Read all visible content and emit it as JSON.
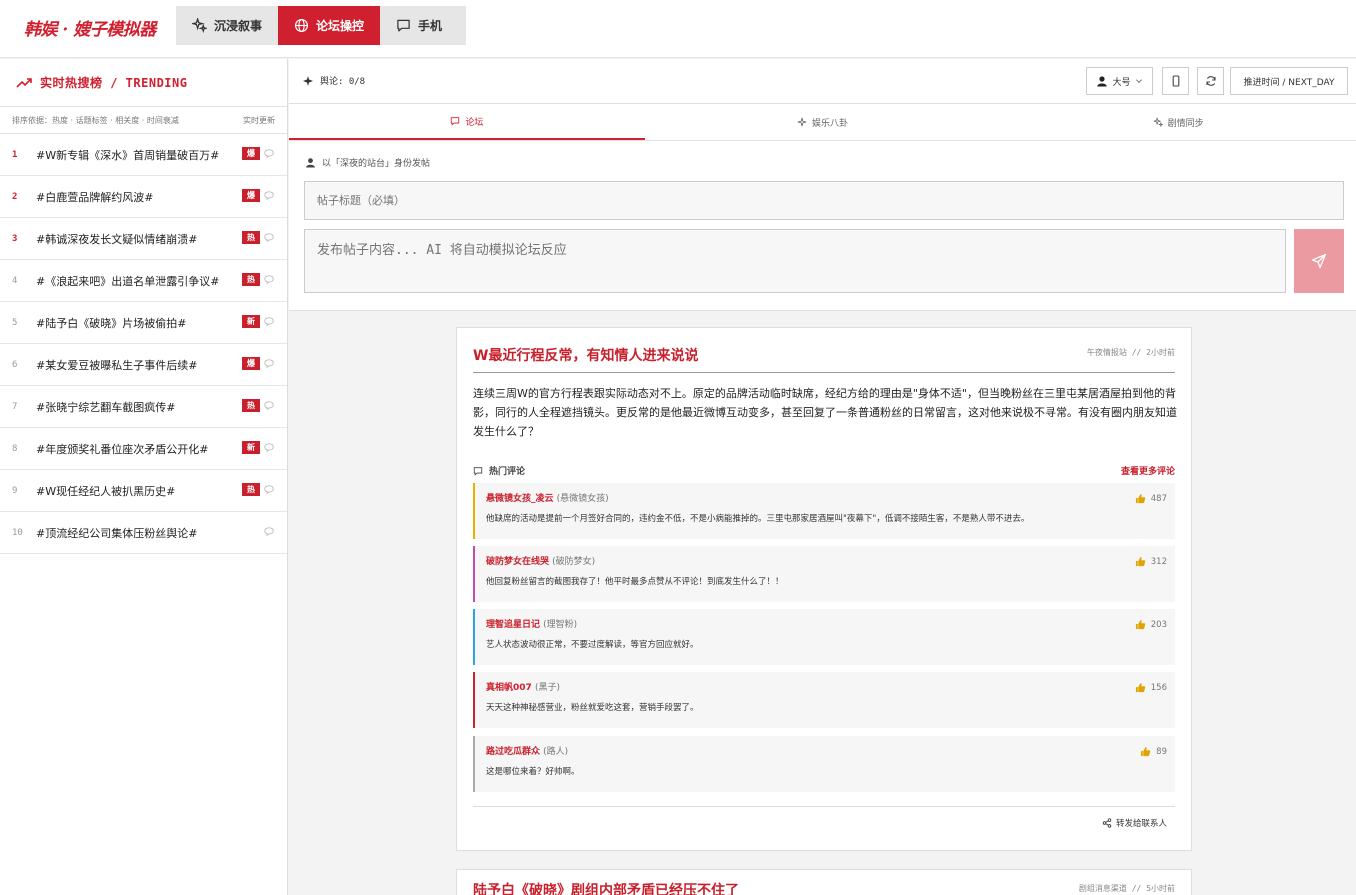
{
  "app": {
    "brand": "韩娱 · 嫂子模拟器",
    "modes": [
      {
        "label": "沉浸叙事",
        "icon": "sparkle-icon"
      },
      {
        "label": "论坛操控",
        "icon": "globe-icon"
      },
      {
        "label": "手机",
        "icon": "message-icon"
      }
    ],
    "active_mode": 1,
    "accent": "#d0202f"
  },
  "sidebar": {
    "title": "实时热搜榜 / TRENDING",
    "sort_text": "排序依据：热度 · 话题标签 · 相关度 · 时间衰减",
    "realtime": "实时更新",
    "items": [
      {
        "rank": "1",
        "title": "#W新专辑《深水》首周销量破百万#",
        "badge": "爆"
      },
      {
        "rank": "2",
        "title": "#白鹿萱品牌解约风波#",
        "badge": "爆"
      },
      {
        "rank": "3",
        "title": "#韩诚深夜发长文疑似情绪崩溃#",
        "badge": "热"
      },
      {
        "rank": "4",
        "title": "#《浪起来吧》出道名单泄露引争议#",
        "badge": "热"
      },
      {
        "rank": "5",
        "title": "#陆予白《破晓》片场被偷拍#",
        "badge": "新"
      },
      {
        "rank": "6",
        "title": "#某女爱豆被曝私生子事件后续#",
        "badge": "爆"
      },
      {
        "rank": "7",
        "title": "#张晓宁综艺翻车截图疯传#",
        "badge": "热"
      },
      {
        "rank": "8",
        "title": "#年度颁奖礼番位座次矛盾公开化#",
        "badge": "新"
      },
      {
        "rank": "9",
        "title": "#W现任经纪人被扒黑历史#",
        "badge": "热"
      },
      {
        "rank": "10",
        "title": "#顶流经纪公司集体压粉丝舆论#",
        "badge": ""
      }
    ]
  },
  "toolbar": {
    "counter": "舆论: 0/8",
    "account": "大号",
    "advance": "推进时间 / NEXT_DAY"
  },
  "tabs": [
    {
      "label": "论坛",
      "icon": "chat-icon"
    },
    {
      "label": "娱乐八卦",
      "icon": "sparkle-icon"
    },
    {
      "label": "剧情同步",
      "icon": "sparkles-icon"
    }
  ],
  "compose": {
    "identity": "以「深夜的站台」身份发帖",
    "title_placeholder": "帖子标题（必填）",
    "body_placeholder": "发布帖子内容... AI 将自动模拟论坛反应"
  },
  "posts": [
    {
      "title": "W最近行程反常，有知情人进来说说",
      "meta": "午夜情报站 // 2小时前",
      "body": "连续三周W的官方行程表跟实际动态对不上。原定的品牌活动临时缺席，经纪方给的理由是\"身体不适\"，但当晚粉丝在三里屯某居酒屋拍到他的背影，同行的人全程遮挡镜头。更反常的是他最近微博互动变多，甚至回复了一条普通粉丝的日常留言，这对他来说极不寻常。有没有圈内朋友知道发生什么了？",
      "hot_label": "热门评论",
      "more_label": "查看更多评论",
      "share_label": "转发给联系人",
      "comments": [
        {
          "name": "悬微镜女孩_凌云",
          "tag": "(悬微镜女孩)",
          "text": "他缺席的活动是提前一个月签好合同的，违约金不低，不是小病能推掉的。三里屯那家居酒屋叫\"夜幕下\"，低调不接陌生客，不是熟人带不进去。",
          "likes": "487",
          "color": "#e5b100"
        },
        {
          "name": "破防梦女在线哭",
          "tag": "(破防梦女)",
          "text": "他回复粉丝留言的截图我存了！他平时最多点赞从不评论！到底发生什么了！！",
          "likes": "312",
          "color": "#c04bb5"
        },
        {
          "name": "理智追星日记",
          "tag": "(理智粉)",
          "text": "艺人状态波动很正常，不要过度解读，等官方回应就好。",
          "likes": "203",
          "color": "#2ba6d9"
        },
        {
          "name": "真相帆007",
          "tag": "(黑子)",
          "text": "天天这种神秘感营业，粉丝就爱吃这套，营销手段罢了。",
          "likes": "156",
          "color": "#d0202f"
        },
        {
          "name": "路过吃瓜群众",
          "tag": "(路人)",
          "text": "这是哪位来着？好帅啊。",
          "likes": "89",
          "color": "#aaaaaa"
        }
      ]
    },
    {
      "title": "陆予白《破晓》剧组内部矛盾已经压不住了",
      "meta": "剧组消息渠道 // 5小时前"
    }
  ]
}
